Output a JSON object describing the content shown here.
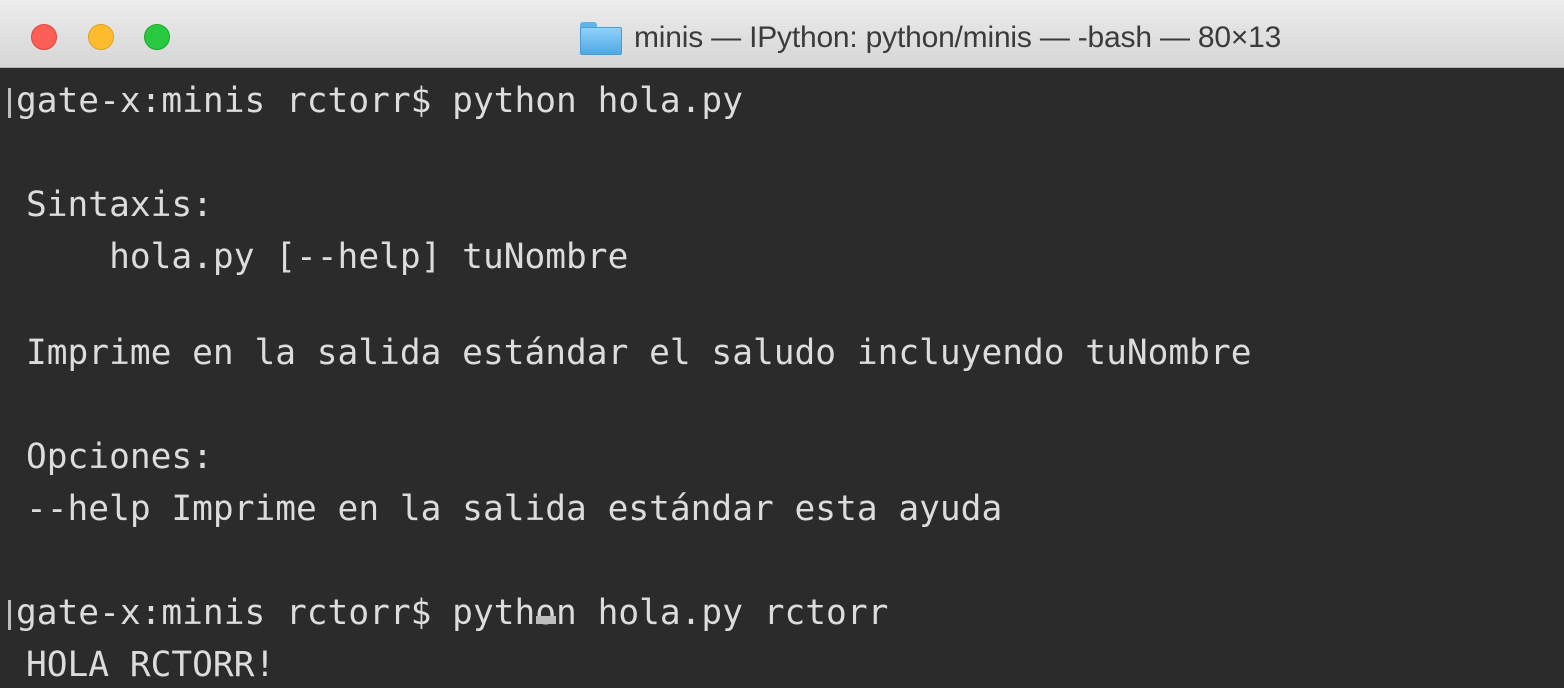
{
  "window": {
    "title": "minis — IPython: python/minis — -bash — 80×13",
    "title_icon": "folder-icon",
    "controls": {
      "close_color": "#fd5f57",
      "minimize_color": "#fdbc2e",
      "zoom_color": "#28c840"
    }
  },
  "terminal": {
    "background": "#2b2b2b",
    "foreground": "#dcdcdc",
    "lines": [
      "gate-x:minis rctorr$ python hola.py",
      "",
      "Sintaxis:",
      "    hola.py [--help] tuNombre",
      "",
      "Imprime en la salida estándar el saludo incluyendo tuNombre",
      "",
      "Opciones:",
      "--help Imprime en la salida estándar esta ayuda",
      "",
      "gate-x:minis rctorr$ python hola.py rctorr",
      "HOLA RCTORR!"
    ]
  }
}
